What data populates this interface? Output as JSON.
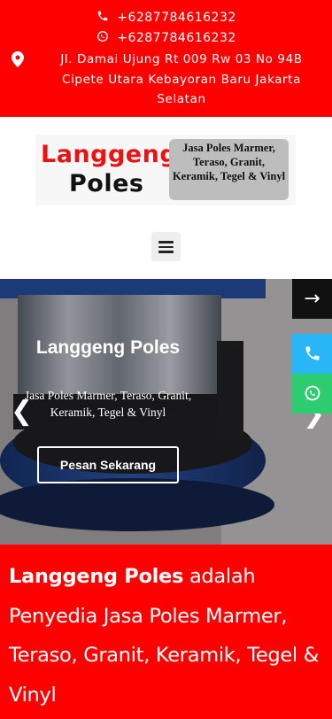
{
  "contact": {
    "phone": "+6287784616232",
    "whatsapp": "+6287784616232",
    "address": "Jl. Damai Ujung Rt 009 Rw 03 No 94B Cipete Utara Kebayoran Baru Jakarta Selatan"
  },
  "logo": {
    "name_line1": "Langgeng",
    "name_line2": "Poles",
    "tagline": "Jasa Poles Marmer, Teraso, Granit, Keramik, Tegel & Vinyl"
  },
  "hero": {
    "title": "Langgeng Poles",
    "subtitle": "Jasa Poles Marmer, Teraso, Granit, Keramik, Tegel & Vinyl",
    "cta_label": "Pesan Sekarang",
    "prev_glyph": "❮",
    "next_glyph": "❯"
  },
  "floating": {
    "next_glyph": "→"
  },
  "about": {
    "brand": "Langgeng Poles",
    "description": " adalah Penyedia Jasa Poles Marmer, Teraso, Granit, Keramik, Tegel & Vinyl"
  },
  "icons": {
    "phone": "phone-icon",
    "whatsapp": "whatsapp-icon",
    "location": "location-pin-icon",
    "menu": "hamburger-menu-icon"
  },
  "colors": {
    "brand_red": "#ff0000",
    "call_blue": "#29b6f6",
    "whatsapp_green": "#2ecc71"
  }
}
